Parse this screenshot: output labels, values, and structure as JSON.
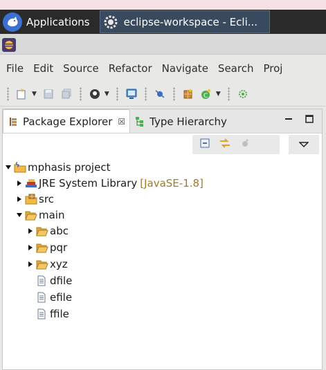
{
  "panel": {
    "applications_label": "Applications",
    "task_label": "eclipse-workspace - Ecli..."
  },
  "menubar": {
    "items": [
      "File",
      "Edit",
      "Source",
      "Refactor",
      "Navigate",
      "Search",
      "Proj"
    ]
  },
  "views": {
    "package_explorer_label": "Package Explorer",
    "package_explorer_close": "☒",
    "type_hierarchy_label": "Type Hierarchy"
  },
  "tree": {
    "project": "mphasis project",
    "jre_label": "JRE System Library",
    "jre_decoration": "[JavaSE-1.8]",
    "src": "src",
    "main": "main",
    "abc": "abc",
    "pqr": "pqr",
    "xyz": "xyz",
    "dfile": "dfile",
    "efile": "efile",
    "ffile": "ffile"
  },
  "colors": {
    "panel_bg": "#2a2a2a",
    "folder": "#f0b94a",
    "decoration": "#a07a2a"
  }
}
